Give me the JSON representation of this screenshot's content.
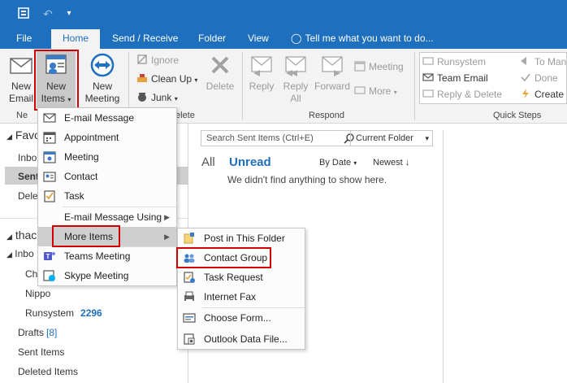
{
  "titlebar": {
    "quick_access": [
      "sendreceive-icon",
      "undo-icon",
      "customize-icon"
    ]
  },
  "tabs": [
    {
      "key": "file",
      "label": "File"
    },
    {
      "key": "home",
      "label": "Home"
    },
    {
      "key": "sendreceive",
      "label": "Send / Receive"
    },
    {
      "key": "folder",
      "label": "Folder"
    },
    {
      "key": "view",
      "label": "View"
    },
    {
      "key": "tellme",
      "label": "Tell me what you want to do..."
    }
  ],
  "ribbon": {
    "new_email": {
      "line1": "New",
      "line2": "Email"
    },
    "new_items": {
      "line1": "New",
      "line2": "Items"
    },
    "new_meeting": {
      "line1": "New",
      "line2": "Meeting"
    },
    "group_new_label": "Ne",
    "ignore": "Ignore",
    "cleanup": "Clean Up",
    "junk": "Junk",
    "delete": "Delete",
    "group_delete_label": "elete",
    "reply": "Reply",
    "reply_all": {
      "line1": "Reply",
      "line2": "All"
    },
    "forward": "Forward",
    "meeting": "Meeting",
    "more": "More",
    "group_respond_label": "Respond",
    "qs_runsystem": "Runsystem",
    "qs_team_email": "Team Email",
    "qs_reply_delete": "Reply & Delete",
    "qs_to_man": "To Man",
    "qs_done": "Done",
    "qs_create": "Create I",
    "group_quicksteps_label": "Quick Steps"
  },
  "nav": {
    "favorites_header": "Favo",
    "inbox_fav": "Inbo",
    "sent_fav": "Sent",
    "deleted_fav": "Delet",
    "account_header": "thac",
    "inbox": "Inbo",
    "ch": "Ch",
    "nippo": "Nippo",
    "runsystem": "Runsystem",
    "runsystem_count": "2296",
    "drafts": "Drafts",
    "drafts_count": "[8]",
    "sent_items": "Sent Items",
    "deleted_items": "Deleted Items"
  },
  "main": {
    "search_placeholder": "Search Sent Items (Ctrl+E)",
    "scope": "Current Folder",
    "filter_all": "All",
    "filter_unread": "Unread",
    "sort_by": "By Date",
    "sort_order": "Newest",
    "empty_message": "We didn't find anything to show here."
  },
  "new_items_menu": [
    {
      "label": "E-mail Message",
      "icon": "email-icon"
    },
    {
      "label": "Appointment",
      "icon": "calendar-icon"
    },
    {
      "label": "Meeting",
      "icon": "meeting-icon"
    },
    {
      "label": "Contact",
      "icon": "contact-card-icon"
    },
    {
      "label": "Task",
      "icon": "task-icon"
    },
    {
      "label": "E-mail Message Using",
      "icon": ""
    },
    {
      "label": "More Items",
      "icon": ""
    },
    {
      "label": "Teams Meeting",
      "icon": "teams-icon"
    },
    {
      "label": "Skype Meeting",
      "icon": "skype-meeting-icon"
    }
  ],
  "more_items_menu": [
    {
      "label": "Post in This Folder",
      "icon": "post-icon"
    },
    {
      "label": "Contact Group",
      "icon": "contact-group-icon"
    },
    {
      "label": "Task Request",
      "icon": "task-request-icon"
    },
    {
      "label": "Internet Fax",
      "icon": "fax-icon"
    },
    {
      "label": "Choose Form...",
      "icon": "form-icon"
    },
    {
      "label": "Outlook Data File...",
      "icon": "data-file-icon"
    }
  ],
  "colors": {
    "accent": "#1e6fbd",
    "highlight_box": "#d00000",
    "menu_hover": "#cfcfcf"
  }
}
